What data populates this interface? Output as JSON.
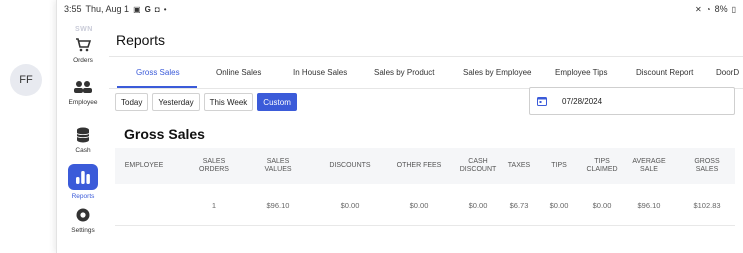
{
  "status_bar": {
    "time": "3:55",
    "date": "Thu, Aug 1",
    "battery": "8%"
  },
  "outer": {
    "avatar_initials": "FF"
  },
  "sidebar": {
    "brand": "SWN",
    "items": [
      {
        "label": "Orders",
        "icon": "cart-icon"
      },
      {
        "label": "Employee",
        "icon": "people-icon"
      },
      {
        "label": "Cash",
        "icon": "coins-icon"
      },
      {
        "label": "Reports",
        "icon": "bar-chart-icon",
        "active": true
      },
      {
        "label": "Settings",
        "icon": "gear-icon"
      }
    ]
  },
  "header": {
    "title": "Reports"
  },
  "tabs": [
    {
      "label": "Gross Sales",
      "active": true
    },
    {
      "label": "Online Sales"
    },
    {
      "label": "In House Sales"
    },
    {
      "label": "Sales by Product"
    },
    {
      "label": "Sales by Employee"
    },
    {
      "label": "Employee Tips"
    },
    {
      "label": "Discount Report"
    },
    {
      "label": "DoorD"
    }
  ],
  "range_buttons": [
    {
      "label": "Today"
    },
    {
      "label": "Yesterday"
    },
    {
      "label": "This Week"
    },
    {
      "label": "Custom",
      "active": true
    }
  ],
  "date_field": {
    "value": "07/28/2024"
  },
  "section": {
    "title": "Gross Sales"
  },
  "table": {
    "headers": [
      "EMPLOYEE",
      "SALES ORDERS",
      "SALES VALUES",
      "DISCOUNTS",
      "OTHER FEES",
      "CASH DISCOUNT",
      "TAXES",
      "TIPS",
      "TIPS CLAIMED",
      "AVERAGE SALE",
      "GROSS SALES"
    ],
    "rows": [
      [
        "",
        "1",
        "$96.10",
        "$0.00",
        "$0.00",
        "$0.00",
        "$6.73",
        "$0.00",
        "$0.00",
        "$96.10",
        "$102.83"
      ]
    ]
  },
  "colors": {
    "accent": "#3b5bd9"
  }
}
